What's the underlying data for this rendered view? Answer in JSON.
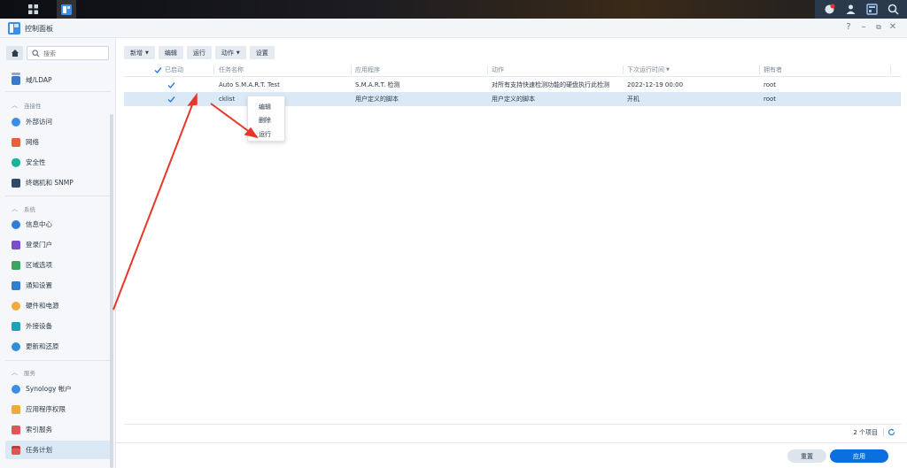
{
  "window": {
    "title": "控制面板"
  },
  "sidebar": {
    "search_placeholder": "搜索",
    "top_items": [
      {
        "label": "域/LDAP",
        "icon": "directory-icon"
      }
    ],
    "sections": [
      {
        "title": "连接性",
        "items": [
          {
            "label": "外部访问",
            "icon": "external-access-icon"
          },
          {
            "label": "网络",
            "icon": "network-icon"
          },
          {
            "label": "安全性",
            "icon": "shield-icon"
          },
          {
            "label": "终端机和 SNMP",
            "icon": "terminal-icon"
          }
        ]
      },
      {
        "title": "系统",
        "items": [
          {
            "label": "信息中心",
            "icon": "info-icon"
          },
          {
            "label": "登录门户",
            "icon": "portal-icon"
          },
          {
            "label": "区域选项",
            "icon": "region-icon"
          },
          {
            "label": "通知设置",
            "icon": "notification-icon"
          },
          {
            "label": "硬件和电源",
            "icon": "lightbulb-icon"
          },
          {
            "label": "外接设备",
            "icon": "external-device-icon"
          },
          {
            "label": "更新和还原",
            "icon": "update-icon"
          }
        ]
      },
      {
        "title": "服务",
        "items": [
          {
            "label": "Synology 帐户",
            "icon": "account-icon"
          },
          {
            "label": "应用程序权限",
            "icon": "lock-icon"
          },
          {
            "label": "索引服务",
            "icon": "index-icon"
          },
          {
            "label": "任务计划",
            "icon": "calendar-icon",
            "active": true
          }
        ]
      }
    ]
  },
  "toolbar": {
    "create": "新增",
    "edit": "编辑",
    "run": "运行",
    "action": "动作",
    "settings": "设置"
  },
  "table": {
    "columns": {
      "enabled": "已启动",
      "task": "任务名称",
      "app": "应用程序",
      "action": "动作",
      "next_run": "下次运行时间",
      "owner": "拥有者"
    },
    "rows": [
      {
        "enabled": true,
        "task": "Auto S.M.A.R.T. Test",
        "app": "S.M.A.R.T. 检测",
        "action": "对所有支持快速检测功能的硬盘执行此检测",
        "next_run": "2022-12-19 00:00",
        "owner": "root",
        "selected": false
      },
      {
        "enabled": true,
        "task": "cklist",
        "app": "用户定义的脚本",
        "action": "用户定义的脚本",
        "next_run": "开机",
        "owner": "root",
        "selected": true
      }
    ],
    "count": "2 个项目"
  },
  "context_menu": {
    "edit": "编辑",
    "delete": "删除",
    "run": "运行"
  },
  "footer": {
    "reset": "重置",
    "apply": "应用"
  },
  "colors": {
    "accent": "#0b6fe0",
    "selected_row": "#dbe9f7",
    "annotation_arrow": "#e8372a"
  }
}
